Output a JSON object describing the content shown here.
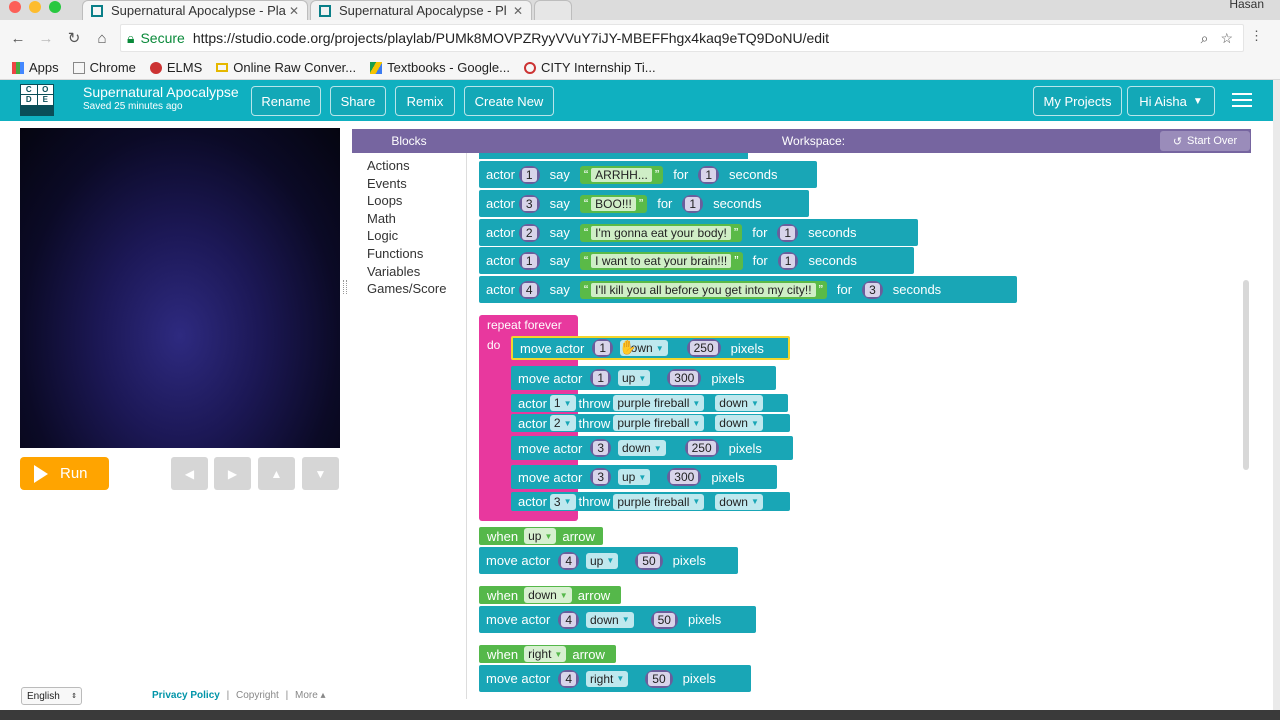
{
  "browser": {
    "tabs": [
      {
        "title": "Supernatural Apocalypse - Pla"
      },
      {
        "title": "Supernatural Apocalypse - Pl"
      }
    ],
    "profile": "Hasan",
    "secure_label": "Secure",
    "url": "https://studio.code.org/projects/playlab/PUMk8MOVPZRyyVVuY7iJY-MBEFFhgx4kaq9eTQ9DoNU/edit",
    "bookmarks": [
      "Apps",
      "Chrome",
      "ELMS",
      "Online Raw Conver...",
      "Textbooks - Google...",
      "CITY Internship Ti..."
    ]
  },
  "appbar": {
    "logo_letters": [
      "C",
      "O",
      "D",
      "E"
    ],
    "project_title": "Supernatural Apocalypse",
    "saved": "Saved 25 minutes ago",
    "buttons": {
      "rename": "Rename",
      "share": "Share",
      "remix": "Remix",
      "create_new": "Create New"
    },
    "my_projects": "My Projects",
    "user": "Hi Aisha"
  },
  "controls": {
    "run": "Run"
  },
  "footer": {
    "language": "English",
    "privacy": "Privacy Policy",
    "sep": "|",
    "copyright": "Copyright",
    "more": "More ▴"
  },
  "header": {
    "blocks": "Blocks",
    "workspace": "Workspace:",
    "start_over": "Start Over"
  },
  "categories": [
    "Actions",
    "Events",
    "Loops",
    "Math",
    "Logic",
    "Functions",
    "Variables",
    "Games/Score"
  ],
  "words": {
    "actor": "actor",
    "say": "say",
    "for": "for",
    "seconds": "seconds",
    "move_actor": "move actor",
    "pixels": "pixels",
    "throw": "throw",
    "repeat_forever": "repeat forever",
    "do": "do",
    "when": "when",
    "arrow": "arrow"
  },
  "say_blocks": [
    {
      "actor": "1",
      "text": "ARRHH...",
      "secs": "1"
    },
    {
      "actor": "3",
      "text": "BOO!!!",
      "secs": "1"
    },
    {
      "actor": "2",
      "text": "I'm gonna eat your body!",
      "secs": "1"
    },
    {
      "actor": "1",
      "text": "I want to eat your brain!!!",
      "secs": "1"
    },
    {
      "actor": "4",
      "text": "I'll kill you all before you get into my city!!",
      "secs": "3"
    }
  ],
  "loop_blocks": {
    "move1": {
      "actor": "1",
      "dir": "down",
      "px": "250"
    },
    "move2": {
      "actor": "1",
      "dir": "up",
      "px": "300"
    },
    "throw1": {
      "actor": "1",
      "proj": "purple fireball",
      "dir": "down"
    },
    "throw2": {
      "actor": "2",
      "proj": "purple fireball",
      "dir": "down"
    },
    "move3": {
      "actor": "3",
      "dir": "down",
      "px": "250"
    },
    "move4": {
      "actor": "3",
      "dir": "up",
      "px": "300"
    },
    "throw3": {
      "actor": "3",
      "proj": "purple fireball",
      "dir": "down"
    }
  },
  "events": [
    {
      "key": "up",
      "actor": "4",
      "dir": "up",
      "px": "50"
    },
    {
      "key": "down",
      "actor": "4",
      "dir": "down",
      "px": "50"
    },
    {
      "key": "right",
      "actor": "4",
      "dir": "right",
      "px": "50"
    }
  ],
  "colors": {
    "brand": "#0fb0c0",
    "run": "#ffa400",
    "block": "#19a6b6",
    "repeat": "#e8389e",
    "event": "#55b84a",
    "header": "#7665a0"
  }
}
